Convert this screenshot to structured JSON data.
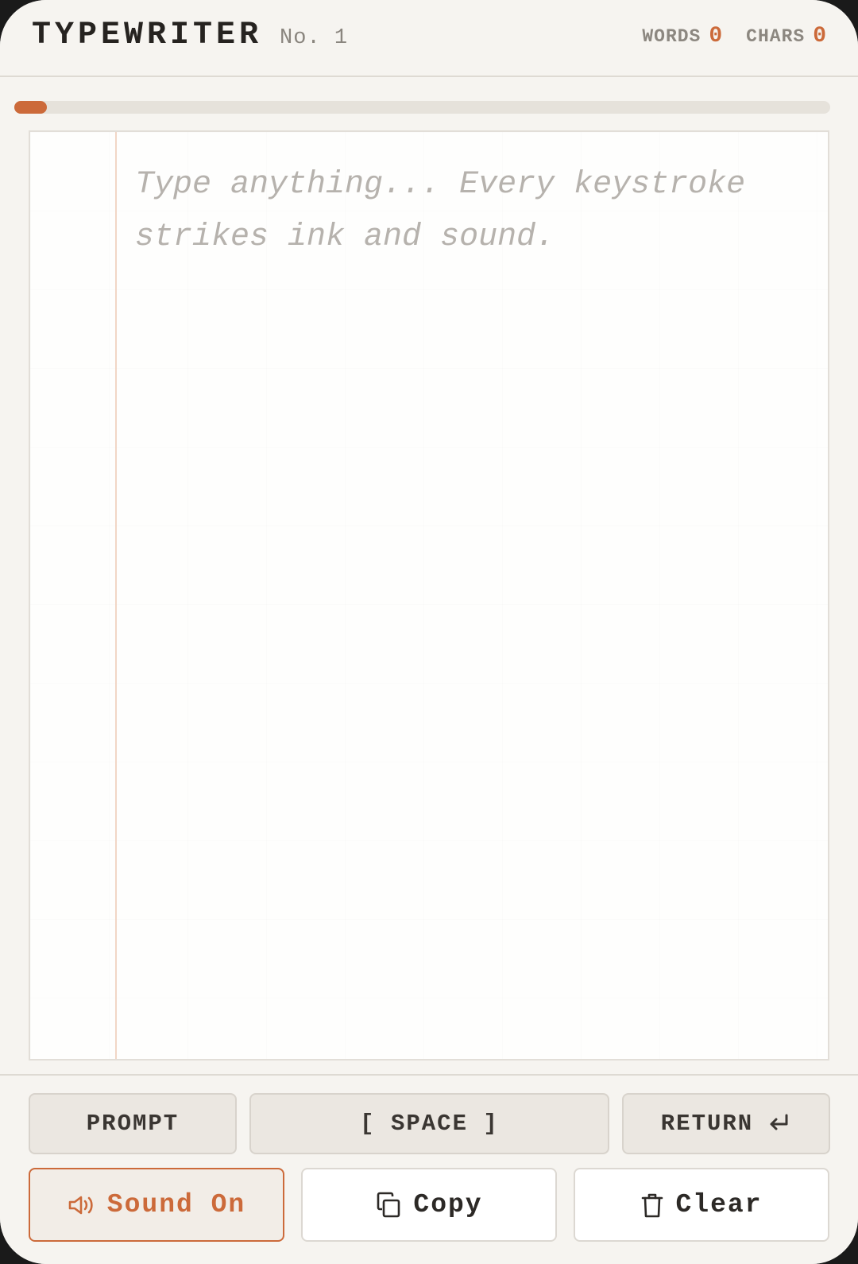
{
  "header": {
    "title": "TYPEWRITER",
    "subtitle": "No. 1",
    "stats": {
      "words_label": "WORDS",
      "words_value": "0",
      "chars_label": "CHARS",
      "chars_value": "0"
    }
  },
  "progress": {
    "value_fraction": 0.04
  },
  "paper": {
    "placeholder": "Type anything... Every keystroke strikes ink and sound.",
    "value": ""
  },
  "keys": {
    "prompt_label": "PROMPT",
    "space_label": "[ SPACE ]",
    "return_label": "RETURN"
  },
  "actions": {
    "sound_label": "Sound On",
    "copy_label": "Copy",
    "clear_label": "Clear"
  },
  "icons": {
    "sound": "speaker-icon",
    "copy": "copy-icon",
    "clear": "trash-icon",
    "return": "return-arrow-icon"
  },
  "colors": {
    "accent": "#cc6a3a",
    "background": "#f6f4f0",
    "paper": "#fefefd",
    "key": "#ebe7e1",
    "text": "#262320"
  }
}
